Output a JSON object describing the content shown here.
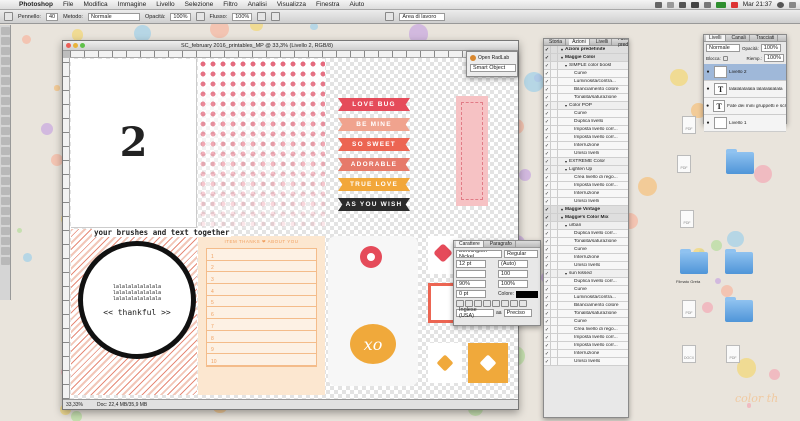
{
  "menubar": {
    "apple": "",
    "app_name": "Photoshop",
    "items": [
      "File",
      "Modifica",
      "Immagine",
      "Livello",
      "Selezione",
      "Filtro",
      "Analisi",
      "Visualizza",
      "Finestra",
      "Aiuto"
    ],
    "clock": "Mar 21:37"
  },
  "options_bar": {
    "brush_label": "Pennello:",
    "brush_size": "40",
    "mode_label": "Metodo:",
    "mode_value": "Normale",
    "opacity_label": "Opacità:",
    "opacity_value": "100%",
    "flow_label": "Flusso:",
    "flow_value": "100%",
    "workspace": "Area di lavoro"
  },
  "document": {
    "title": "SC_february 2016_printables_MP @ 33,3% (Livello 2, RGB/8)",
    "zoom": "33,33%",
    "doc_size": "Doc: 22,4 MB/35,9 MB",
    "card_number": "2",
    "brush_text": "your brushes and text together",
    "circle_lines": [
      "lalalalalalalala",
      "lalalalalalalala",
      "lalalalalalalala"
    ],
    "circle_word": "<< thankful >>",
    "banners": [
      {
        "text": "LOVE BUG",
        "color": "#e54b5a"
      },
      {
        "text": "BE MINE",
        "color": "#f0a38e"
      },
      {
        "text": "SO SWEET",
        "color": "#ec6552"
      },
      {
        "text": "ADORABLE",
        "color": "#e67a6a"
      },
      {
        "text": "TRUE LOVE",
        "color": "#f2a73a"
      },
      {
        "text": "AS YOU WISH",
        "color": "#2b2b2b"
      }
    ],
    "lined_header": "ITEM THANKS ❤ ABOUT YOU",
    "lined_numbers": [
      "1",
      "2",
      "3",
      "4",
      "5",
      "6",
      "7",
      "8",
      "9",
      "10"
    ],
    "tag_text": "xo"
  },
  "radlab": {
    "open_label": "Open RadLab",
    "smart_label": "Smart Object"
  },
  "character_panel": {
    "tabs": [
      "Carattere",
      "Paragrafo"
    ],
    "font_family": "Bonnington Nickel...",
    "font_style": "Regular",
    "size": "12 pt",
    "leading": "(Auto)",
    "tracking": "100",
    "kerning": "100%",
    "scale": "90%",
    "vscale": "100%",
    "baseline": "0 pt",
    "color_label": "Colore:",
    "language": "Inglese (USA)",
    "aa_label": "aa",
    "aa_value": "Preciso"
  },
  "actions_panel": {
    "tabs": [
      "Storia",
      "Azioni",
      "Livelli",
      "Azioni predefinite"
    ],
    "rows": [
      {
        "t": "Azioni predefinite",
        "k": "set"
      },
      {
        "t": "Maggie Color",
        "k": "set"
      },
      {
        "t": "SIMPLE color boost",
        "k": "act"
      },
      {
        "t": "Curve",
        "k": "step"
      },
      {
        "t": "Luminosità/contra...",
        "k": "step"
      },
      {
        "t": "Bilanciamento colore",
        "k": "step"
      },
      {
        "t": "Tonalità/saturazione",
        "k": "step"
      },
      {
        "t": "Color POP",
        "k": "act"
      },
      {
        "t": "Curve",
        "k": "step"
      },
      {
        "t": "Duplica livello",
        "k": "step"
      },
      {
        "t": "Imposta livello corr...",
        "k": "step"
      },
      {
        "t": "Imposta livello corr...",
        "k": "step"
      },
      {
        "t": "Interruzione",
        "k": "step"
      },
      {
        "t": "Unisci livelli",
        "k": "step"
      },
      {
        "t": "EXTREME Color",
        "k": "act"
      },
      {
        "t": "Lighten Up",
        "k": "act"
      },
      {
        "t": "Crea livello di rego...",
        "k": "step"
      },
      {
        "t": "Imposta livello corr...",
        "k": "step"
      },
      {
        "t": "Interruzione",
        "k": "step"
      },
      {
        "t": "Unisci livelli",
        "k": "step"
      },
      {
        "t": "Maggie Vintage",
        "k": "set"
      },
      {
        "t": "Maggie's Color Mix",
        "k": "set"
      },
      {
        "t": "urban",
        "k": "act"
      },
      {
        "t": "Duplica livello corr...",
        "k": "step"
      },
      {
        "t": "Tonalità/saturazione",
        "k": "step"
      },
      {
        "t": "Curve",
        "k": "step"
      },
      {
        "t": "Interruzione",
        "k": "step"
      },
      {
        "t": "Unisci livello",
        "k": "step"
      },
      {
        "t": "sun kissed",
        "k": "act"
      },
      {
        "t": "Duplica livello corr...",
        "k": "step"
      },
      {
        "t": "Curve",
        "k": "step"
      },
      {
        "t": "Luminosità/contra...",
        "k": "step"
      },
      {
        "t": "Bilanciamento colore",
        "k": "step"
      },
      {
        "t": "Tonalità/saturazione",
        "k": "step"
      },
      {
        "t": "Curve",
        "k": "step"
      },
      {
        "t": "Crea livello di rego...",
        "k": "step"
      },
      {
        "t": "Imposta livello corr...",
        "k": "step"
      },
      {
        "t": "Imposta livello corr...",
        "k": "step"
      },
      {
        "t": "Interruzione",
        "k": "step"
      },
      {
        "t": "Unisci livello",
        "k": "step"
      }
    ]
  },
  "layers_panel": {
    "tabs": [
      "Livelli",
      "Canali",
      "Tracciati"
    ],
    "blend": "Normale",
    "opacity_label": "Opacità:",
    "opacity_value": "100%",
    "lock_label": "Blocca:",
    "fill_label": "Riemp.:",
    "fill_value": "100%",
    "layers": [
      {
        "name": "Livello 2",
        "thumb": "",
        "sel": true
      },
      {
        "name": "lalalalalalala lalalalalalala",
        "thumb": "T",
        "sel": false
      },
      {
        "name": "Fate dei mini gruppetti e scrit...",
        "thumb": "T",
        "sel": false
      },
      {
        "name": "Livello 1",
        "thumb": "",
        "sel": false
      }
    ]
  },
  "desktop": {
    "files": [
      {
        "label": "PDF"
      },
      {
        "label": "PDF"
      },
      {
        "label": "PDF"
      },
      {
        "label": "PDF"
      },
      {
        "label": "DOCX"
      },
      {
        "label": "PDF"
      }
    ],
    "folder_label": "Filmato Greta",
    "watermark": "color th"
  }
}
